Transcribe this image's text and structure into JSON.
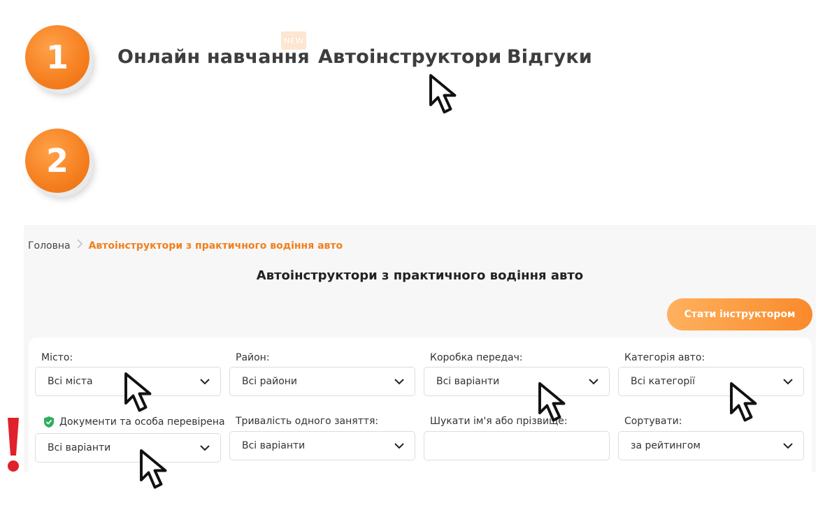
{
  "steps": {
    "one": "1",
    "two": "2"
  },
  "nav": {
    "online": "Онлайн навчання",
    "new_badge": "NEW",
    "instructors": "Автоінструктори",
    "reviews": "Відгуки"
  },
  "breadcrumb": {
    "home": "Головна",
    "separator": ">",
    "current": "Автоінструктори з практичного водіння авто"
  },
  "page_title": "Автоінструктори з практичного водіння авто",
  "become_button": "Стати інструктором",
  "filters": {
    "city": {
      "label": "Місто:",
      "value": "Всі міста"
    },
    "district": {
      "label": "Район:",
      "value": "Всі райони"
    },
    "gearbox": {
      "label": "Коробка передач:",
      "value": "Всі варіанти"
    },
    "category": {
      "label": "Категорія авто:",
      "value": "Всі категорії"
    },
    "verified": {
      "label": "Документи та особа перевірена",
      "value": "Всі варіанти"
    },
    "duration": {
      "label": "Тривалість одного заняття:",
      "value": "Всі варіанти"
    },
    "search": {
      "label": "Шукати ім'я або прізвище:",
      "value": ""
    },
    "sort": {
      "label": "Сортувати:",
      "value": "за рейтингом"
    }
  },
  "colors": {
    "accent": "#f27f1c",
    "verified": "#2fae5e",
    "warning": "#e0202a"
  }
}
